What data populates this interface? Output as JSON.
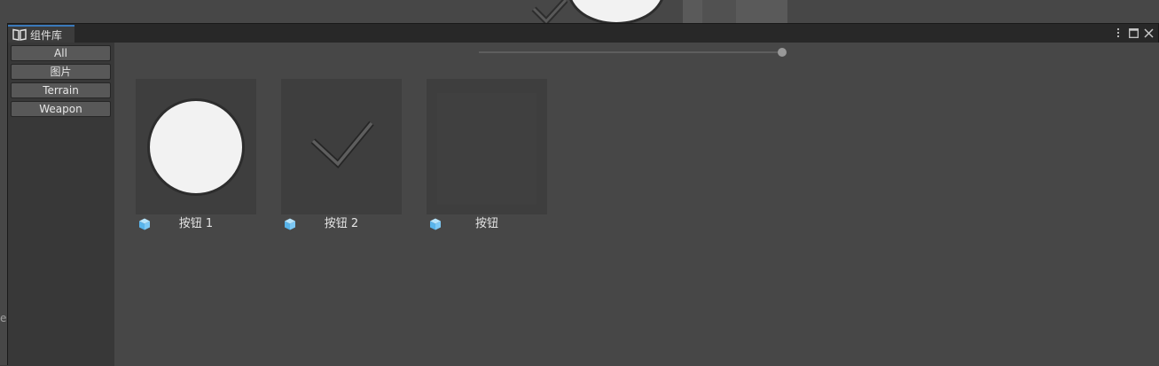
{
  "window": {
    "tab_title": "组件库",
    "tab_icon": "book-icon",
    "controls": [
      "more-icon",
      "maximize-icon",
      "close-icon"
    ]
  },
  "sidebar": {
    "items": [
      {
        "label": "All"
      },
      {
        "label": "图片"
      },
      {
        "label": "Terrain"
      },
      {
        "label": "Weapon"
      }
    ]
  },
  "grid": {
    "zoom_slider_value": 1.0,
    "items": [
      {
        "name": "按钮 1",
        "thumbnail": "circle",
        "icon": "prefab-cube-icon"
      },
      {
        "name": "按钮 2",
        "thumbnail": "checkmark",
        "icon": "prefab-cube-icon"
      },
      {
        "name": "按钮",
        "thumbnail": "blank",
        "icon": "prefab-cube-icon"
      }
    ]
  },
  "background": {
    "partial_text": "e"
  },
  "colors": {
    "tab_accent": "#3a79bb",
    "prefab_icon": "#7cc8f4",
    "panel_bg": "#474747",
    "sidebar_bg": "#383838"
  }
}
